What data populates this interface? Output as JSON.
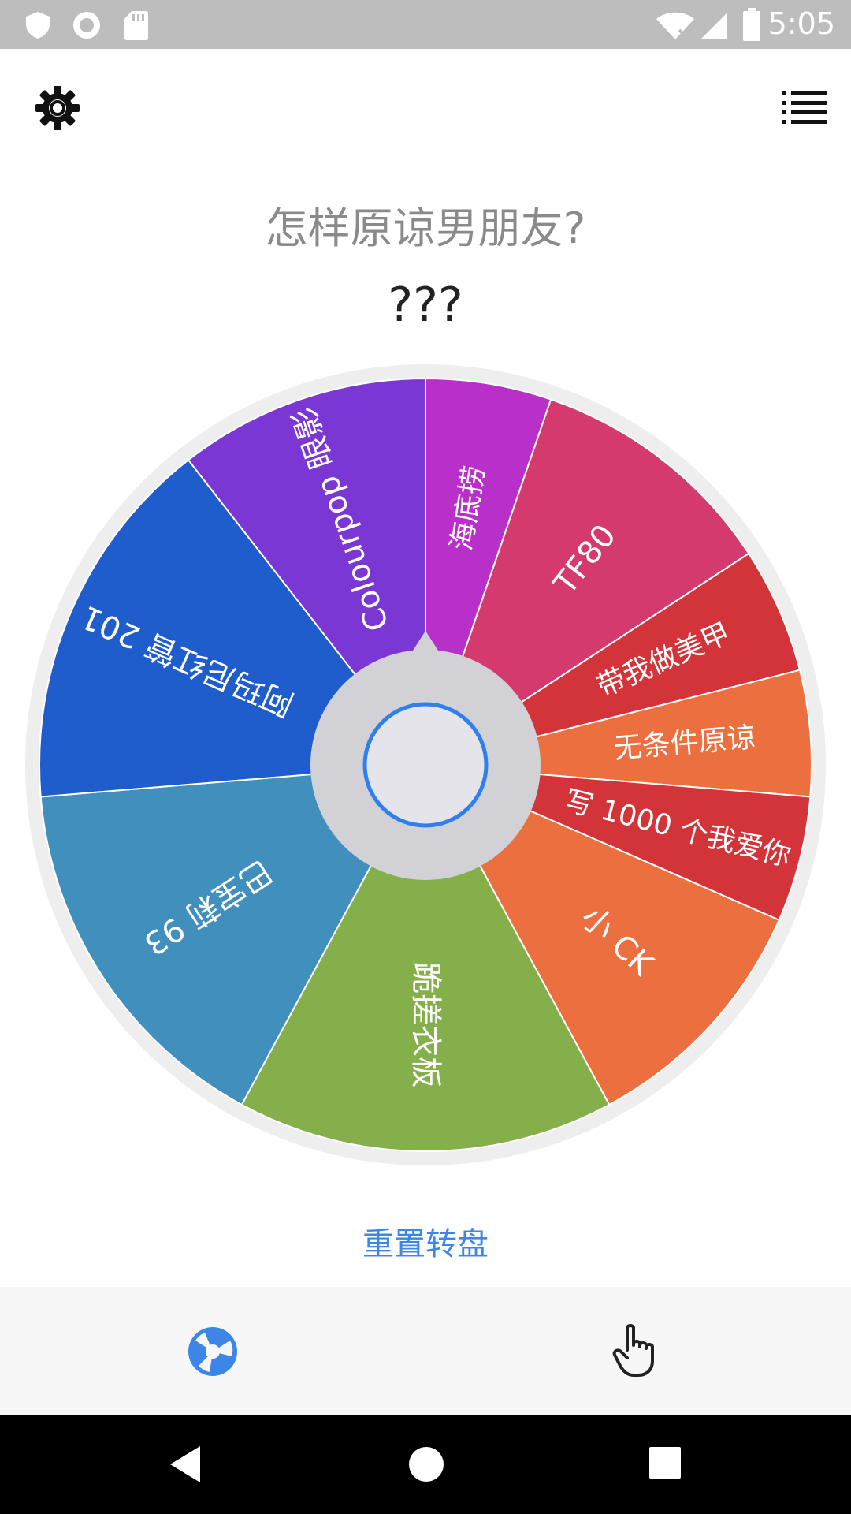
{
  "status_bar": {
    "time": "5:05",
    "icons": [
      "shield-icon",
      "record-icon",
      "sd-card-icon",
      "wifi-off-icon",
      "signal-icon",
      "battery-icon"
    ]
  },
  "app_bar": {
    "left_icon": "gear-icon",
    "right_icon": "list-icon"
  },
  "question": "怎样原谅男朋友?",
  "result": "???",
  "wheel": {
    "segments": [
      {
        "label": "海底捞",
        "color": "#b92fc9",
        "weight": 1
      },
      {
        "label": "TF80",
        "color": "#d43a6e",
        "weight": 2
      },
      {
        "label": "带我做美甲",
        "color": "#d3343a",
        "weight": 1
      },
      {
        "label": "无条件原谅",
        "color": "#eb6f3f",
        "weight": 1
      },
      {
        "label": "写 1000 个我爱你",
        "color": "#d3343a",
        "weight": 1
      },
      {
        "label": "小 CK",
        "color": "#eb6f3f",
        "weight": 2
      },
      {
        "label": "跪搓衣板",
        "color": "#84af4a",
        "weight": 3
      },
      {
        "label": "巴宝莉 93",
        "color": "#418fbd",
        "weight": 3
      },
      {
        "label": "阿玛尼红管 201",
        "color": "#1f5ccc",
        "weight": 3
      },
      {
        "label": "Colourpop 眼影",
        "color": "#7b37d4",
        "weight": 2
      }
    ]
  },
  "reset_label": "重置转盘",
  "bottom_nav": {
    "items": [
      {
        "icon": "wheel-icon",
        "color": "#3d86e8"
      },
      {
        "icon": "hand-pointer-icon",
        "color": "#222222"
      }
    ]
  },
  "system_nav": [
    "back-icon",
    "home-icon",
    "recents-icon"
  ]
}
